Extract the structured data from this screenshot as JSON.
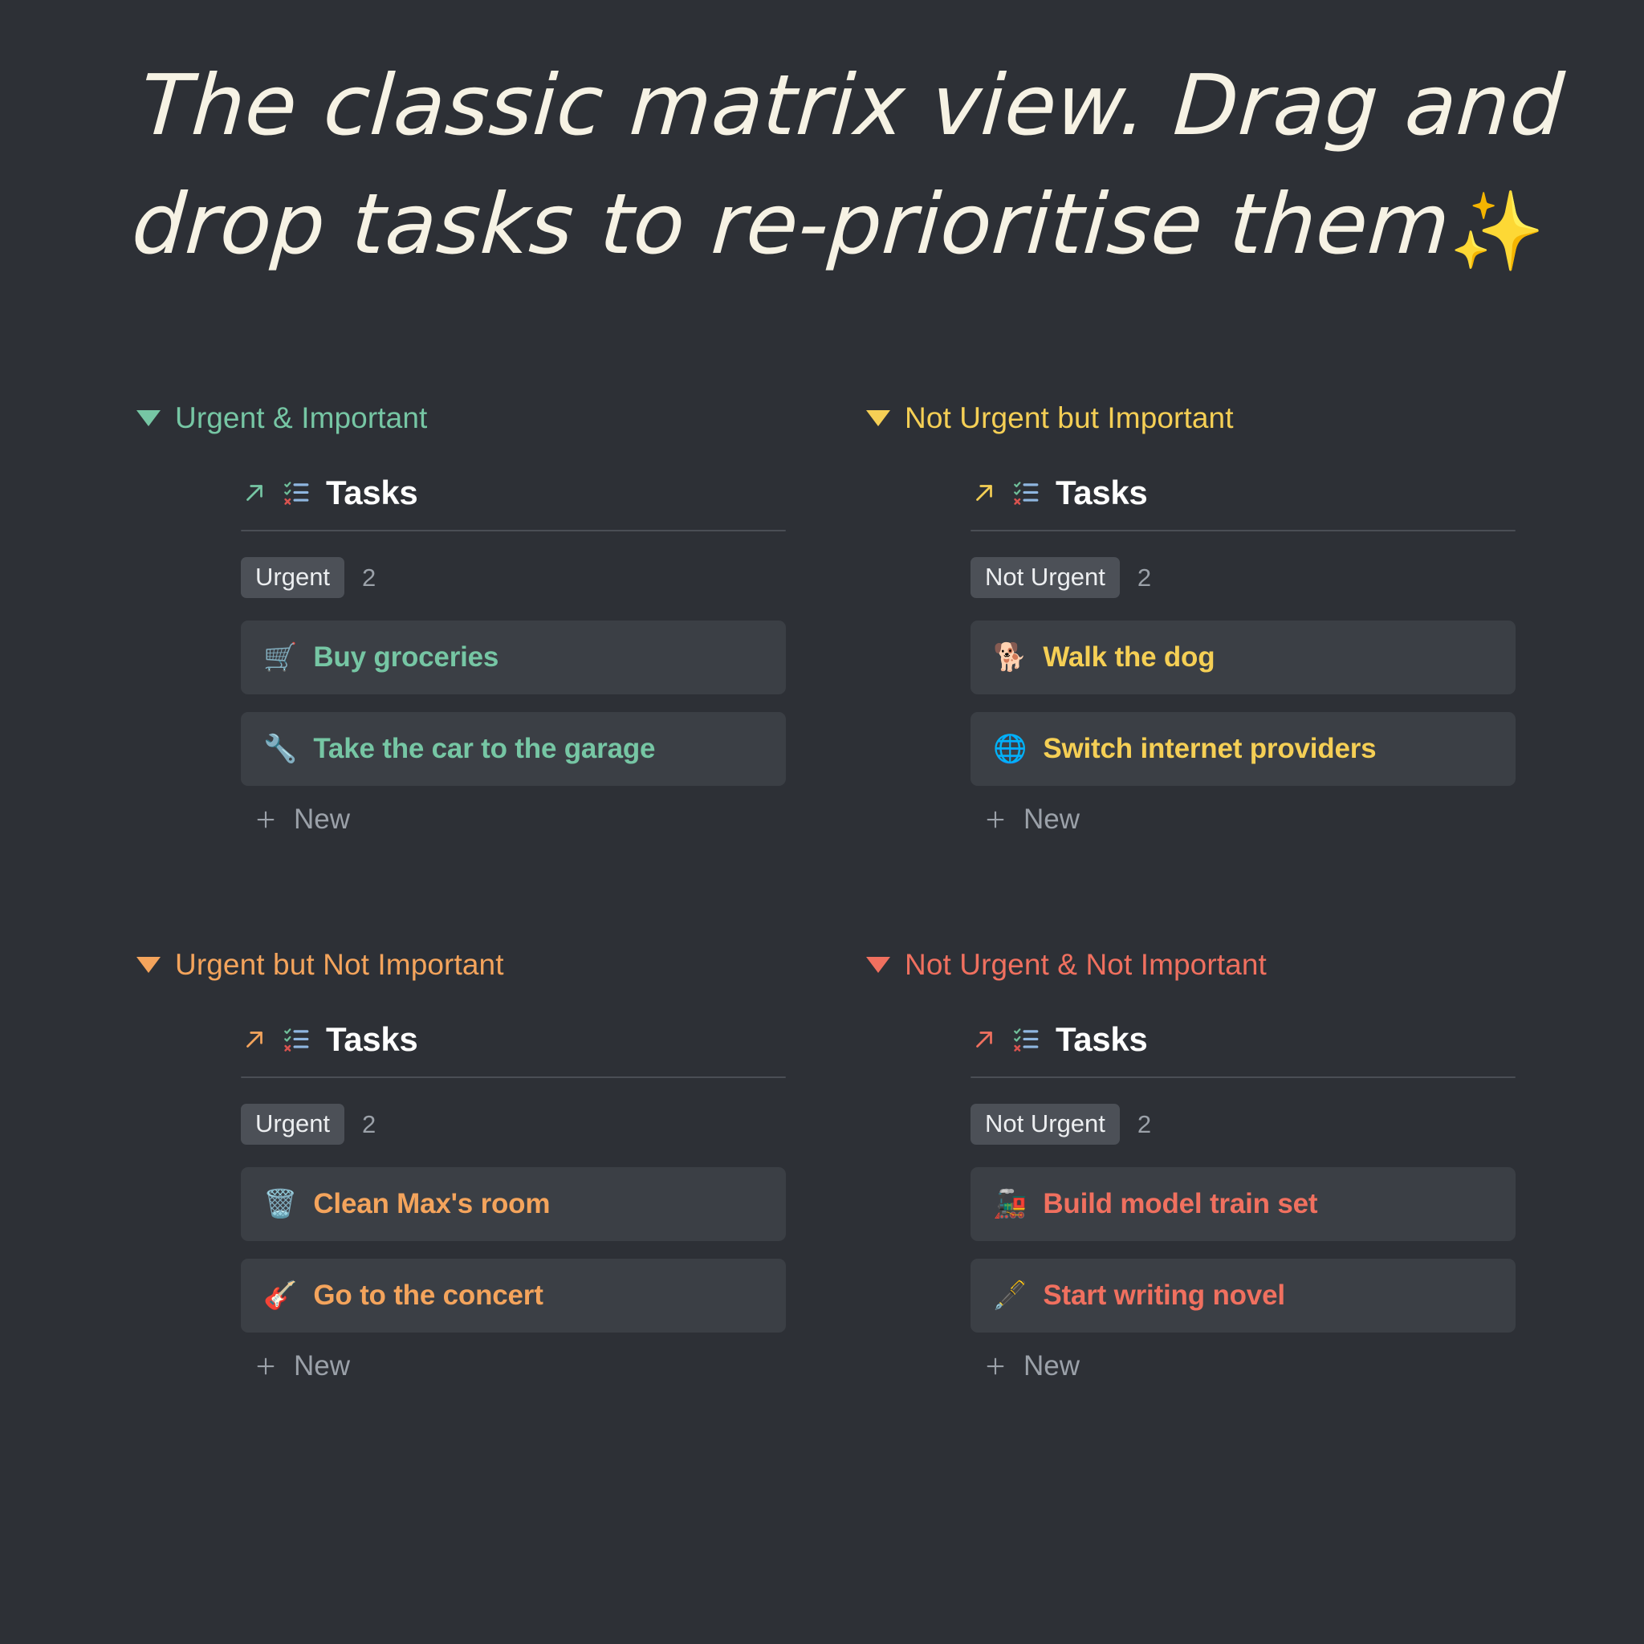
{
  "headline": {
    "line1": "The classic matrix view. Drag and",
    "line2": "drop tasks to re-prioritise them",
    "sparkle_emoji": "✨",
    "color": "#f6f2e4"
  },
  "colors": {
    "background": "#2d3036",
    "card": "#3b3f45",
    "pill": "#4c5057",
    "divider": "#4a4e55",
    "muted_text": "#9ba1a9",
    "green": "#76c6a4",
    "yellow": "#f5cf55",
    "orange": "#f4a45c",
    "red": "#f0705f"
  },
  "quadrants": [
    {
      "title": "Urgent & Important",
      "accent": "#76c6a4",
      "caret_icon": "caret-down-icon",
      "block": {
        "link_icon": "arrow-up-right-icon",
        "database_icon": "checklist-icon",
        "title": "Tasks",
        "group_label": "Urgent",
        "group_count": "2",
        "new_label": "New",
        "plus_icon": "plus-icon",
        "tasks": [
          {
            "emoji": "🛒",
            "emoji_name": "shopping-cart-emoji",
            "text": "Buy groceries"
          },
          {
            "emoji": "🔧",
            "emoji_name": "wrench-emoji",
            "text": "Take the car to the garage"
          }
        ]
      }
    },
    {
      "title": "Not Urgent but Important",
      "accent": "#f5cf55",
      "caret_icon": "caret-down-icon",
      "block": {
        "link_icon": "arrow-up-right-icon",
        "database_icon": "checklist-icon",
        "title": "Tasks",
        "group_label": "Not Urgent",
        "group_count": "2",
        "new_label": "New",
        "plus_icon": "plus-icon",
        "tasks": [
          {
            "emoji": "🐕",
            "emoji_name": "dog-emoji",
            "text": "Walk the dog"
          },
          {
            "emoji": "🌐",
            "emoji_name": "globe-emoji",
            "text": "Switch internet providers"
          }
        ]
      }
    },
    {
      "title": "Urgent but Not Important",
      "accent": "#f4a45c",
      "caret_icon": "caret-down-icon",
      "block": {
        "link_icon": "arrow-up-right-icon",
        "database_icon": "checklist-icon",
        "title": "Tasks",
        "group_label": "Urgent",
        "group_count": "2",
        "new_label": "New",
        "plus_icon": "plus-icon",
        "tasks": [
          {
            "emoji": "🗑️",
            "emoji_name": "wastebasket-emoji",
            "text": "Clean Max's room"
          },
          {
            "emoji": "🎸",
            "emoji_name": "guitar-emoji",
            "text": "Go to the concert"
          }
        ]
      }
    },
    {
      "title": "Not Urgent & Not Important",
      "accent": "#f0705f",
      "caret_icon": "caret-down-icon",
      "block": {
        "link_icon": "arrow-up-right-icon",
        "database_icon": "checklist-icon",
        "title": "Tasks",
        "group_label": "Not Urgent",
        "group_count": "2",
        "new_label": "New",
        "plus_icon": "plus-icon",
        "tasks": [
          {
            "emoji": "🚂",
            "emoji_name": "locomotive-emoji",
            "text": "Build model train set"
          },
          {
            "emoji": "🖋️",
            "emoji_name": "fountain-pen-emoji",
            "text": "Start writing novel"
          }
        ]
      }
    }
  ]
}
